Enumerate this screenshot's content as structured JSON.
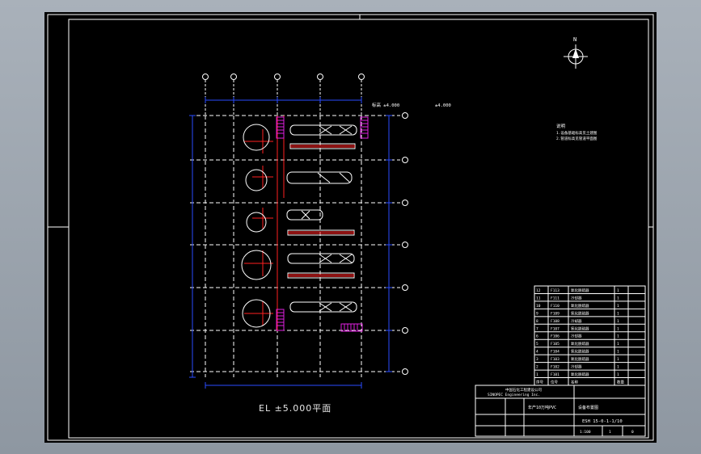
{
  "drawing": {
    "plan_title": "EL ±5.000平面",
    "north_label": "N",
    "elevation_note_1": "标高 ±4.000",
    "elevation_note_2": "±4.000",
    "notes_heading": "说明",
    "notes_line1": "1.设备基础标高见土建图",
    "notes_line2": "2.管道标高见管道平面图"
  },
  "title_block": {
    "company_line1": "中国石化工程建设公司",
    "company_line2": "SINOPEC Engineering Inc.",
    "project": "年产10万吨PVC",
    "sheet_name": "设备布置图",
    "drawing_no": "ESH 15-0-1-1/10",
    "scale": "1:100",
    "sheet": "1",
    "revision": "0"
  },
  "equipment_table": {
    "header": [
      "序号",
      "位号",
      "名称",
      "数量"
    ],
    "rows": [
      [
        "12",
        "F113",
        "氧化脱硫器",
        "1"
      ],
      [
        "11",
        "F111",
        "冷却器",
        "1"
      ],
      [
        "10",
        "F110",
        "氧化脱硫器",
        "1"
      ],
      [
        "9",
        "F109",
        "氧化脱硫器",
        "1"
      ],
      [
        "8",
        "F108",
        "冷却器",
        "1"
      ],
      [
        "7",
        "F107",
        "氧化脱硫器",
        "1"
      ],
      [
        "6",
        "F106",
        "冷却器",
        "1"
      ],
      [
        "5",
        "F105",
        "氧化脱硫器",
        "1"
      ],
      [
        "4",
        "F104",
        "氧化脱硫器",
        "1"
      ],
      [
        "3",
        "F103",
        "氧化脱硫器",
        "1"
      ],
      [
        "2",
        "F102",
        "冷却器",
        "1"
      ],
      [
        "1",
        "F101",
        "氧化脱硫器",
        "1"
      ]
    ]
  },
  "colors": {
    "background": "#000000",
    "grid": "#ffffff",
    "axis": "#ff2020",
    "dimension": "#2a4cff",
    "equipment": "#ffffff",
    "hatch": "#e020e0",
    "frame": "#ffffff"
  }
}
